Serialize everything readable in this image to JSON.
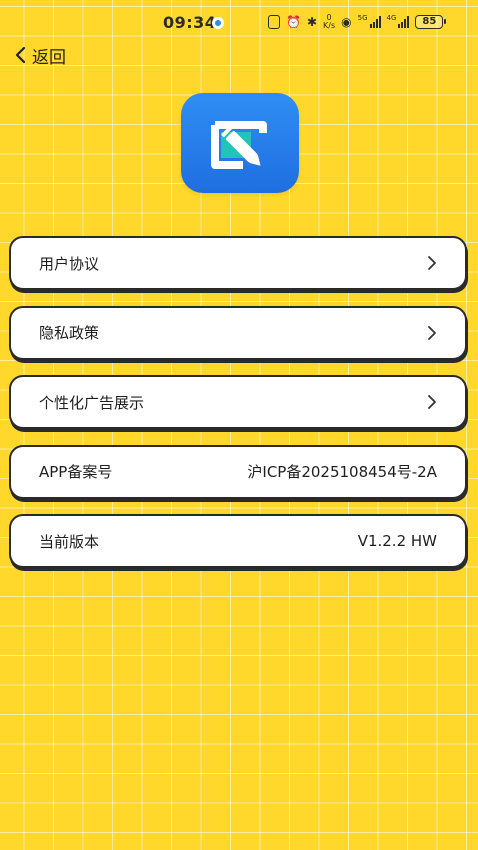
{
  "status_bar": {
    "time": "09:34",
    "speed_top": "0",
    "speed_unit": "K/s",
    "net_5g": "5G",
    "net_4g": "4G",
    "battery": "85"
  },
  "header": {
    "back_label": "返回"
  },
  "app_icon": "edit-note-icon",
  "settings": {
    "items": [
      {
        "label": "用户协议",
        "value": "",
        "has_chevron": true
      },
      {
        "label": "隐私政策",
        "value": "",
        "has_chevron": true
      },
      {
        "label": "个性化广告展示",
        "value": "",
        "has_chevron": true
      },
      {
        "label": "APP备案号",
        "value": "沪ICP备2025108454号-2A",
        "has_chevron": false
      },
      {
        "label": "当前版本",
        "value": "V1.2.2 HW",
        "has_chevron": false
      }
    ]
  },
  "colors": {
    "background": "#FFD82B",
    "card": "#FFFFFF",
    "card_border": "#2A2A2A",
    "icon_blue": "#1F6EE0",
    "icon_teal": "#23C3B8"
  }
}
